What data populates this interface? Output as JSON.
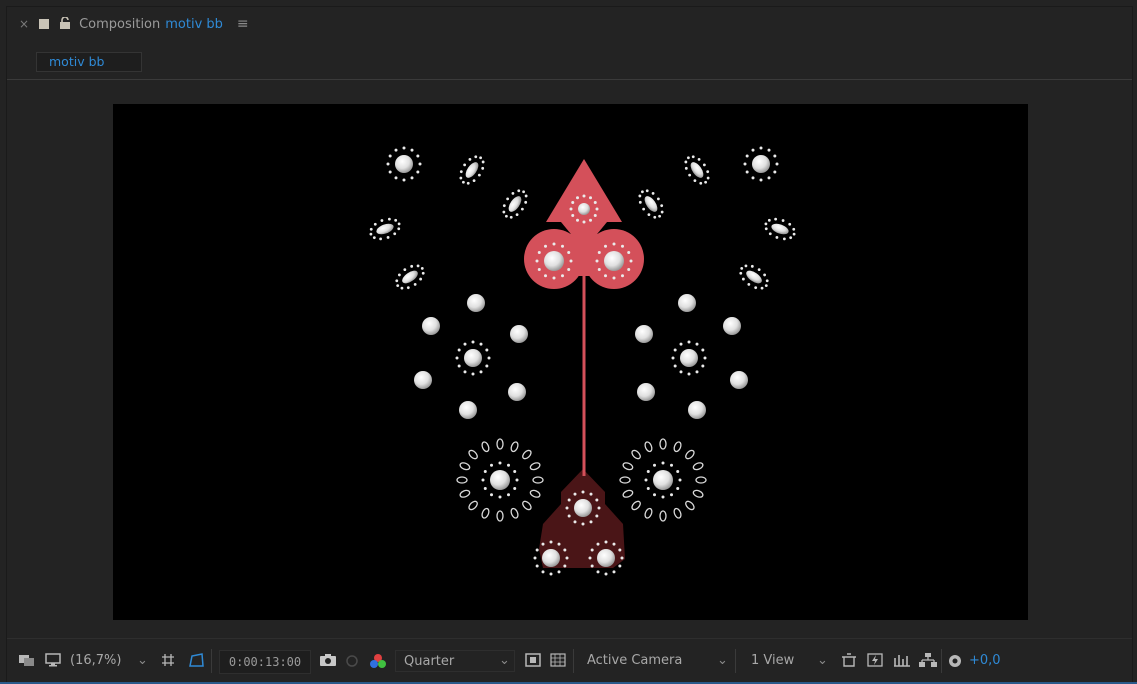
{
  "panel": {
    "close_glyph": "×",
    "title_prefix": "Composition",
    "comp_name": "motiv bb",
    "menu_glyph": "≡",
    "tab_label": "motiv bb"
  },
  "toolbar": {
    "zoom": "(16,7%)",
    "timecode": "0:00:13:00",
    "resolution": "Quarter",
    "camera": "Active Camera",
    "view_layout": "1 View",
    "exposure": "+0,0"
  },
  "colors": {
    "accent_blue": "#2f8ad6",
    "shape_red": "#d4505a",
    "shape_dark_red": "#4a1517",
    "dots_white": "#e8e8e8"
  }
}
